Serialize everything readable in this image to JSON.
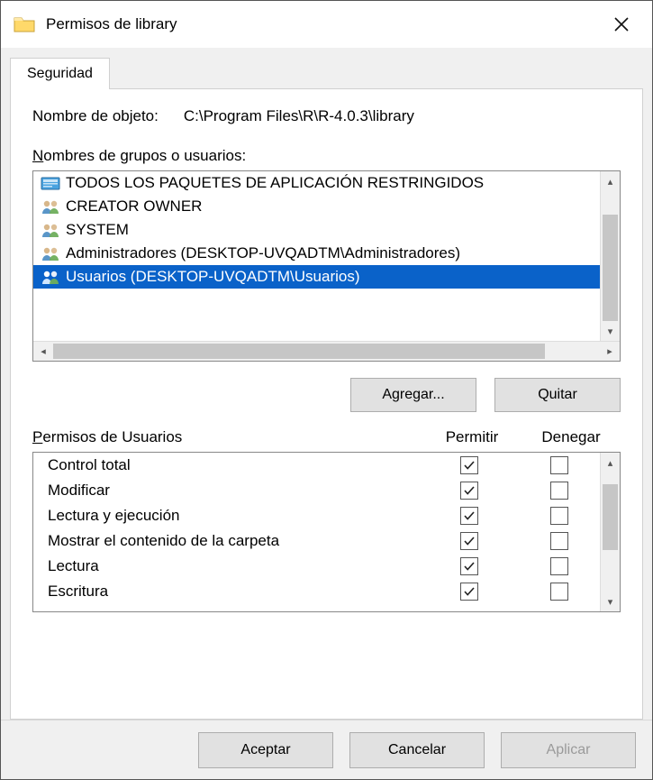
{
  "window": {
    "title": "Permisos de library"
  },
  "tab": {
    "label": "Seguridad"
  },
  "objectName": {
    "label": "Nombre de objeto:",
    "value": "C:\\Program Files\\R\\R-4.0.3\\library"
  },
  "groupsLabel": "Nombres de grupos o usuarios:",
  "groups": [
    {
      "icon": "package",
      "label": "TODOS LOS PAQUETES DE APLICACIÓN RESTRINGIDOS",
      "selected": false
    },
    {
      "icon": "users",
      "label": "CREATOR OWNER",
      "selected": false
    },
    {
      "icon": "users",
      "label": "SYSTEM",
      "selected": false
    },
    {
      "icon": "users",
      "label": "Administradores (DESKTOP-UVQADTM\\Administradores)",
      "selected": false
    },
    {
      "icon": "users",
      "label": "Usuarios (DESKTOP-UVQADTM\\Usuarios)",
      "selected": true
    }
  ],
  "buttons": {
    "add": "Agregar...",
    "remove": "Quitar"
  },
  "permHeader": {
    "label": "Permisos de Usuarios",
    "allow": "Permitir",
    "deny": "Denegar"
  },
  "permissions": [
    {
      "name": "Control total",
      "allow": true,
      "deny": false
    },
    {
      "name": "Modificar",
      "allow": true,
      "deny": false
    },
    {
      "name": "Lectura y ejecución",
      "allow": true,
      "deny": false
    },
    {
      "name": "Mostrar el contenido de la carpeta",
      "allow": true,
      "deny": false
    },
    {
      "name": "Lectura",
      "allow": true,
      "deny": false
    },
    {
      "name": "Escritura",
      "allow": true,
      "deny": false
    }
  ],
  "footer": {
    "ok": "Aceptar",
    "cancel": "Cancelar",
    "apply": "Aplicar"
  }
}
